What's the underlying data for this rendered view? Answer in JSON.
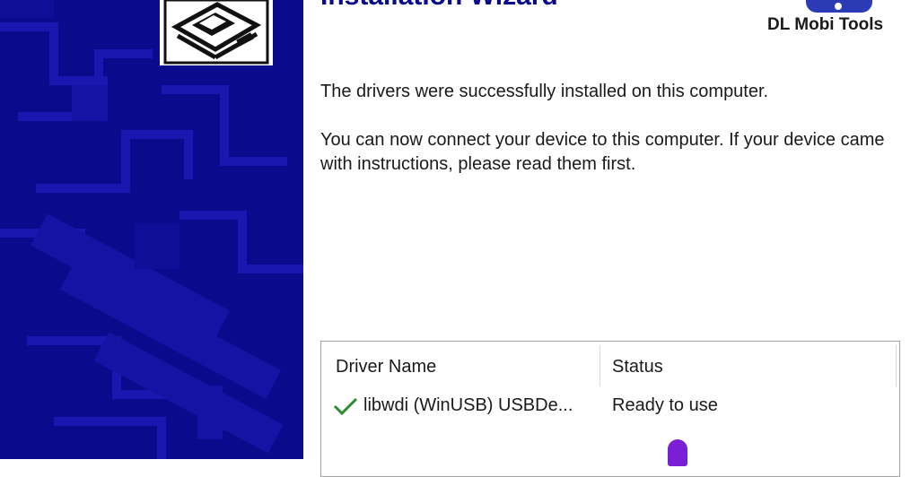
{
  "wizard": {
    "title": "Installation Wizard",
    "brand_name": "DL Mobi Tools",
    "message_success": "The drivers were successfully installed on this computer.",
    "message_connect": "You can now connect your device to this computer. If your device came with instructions, please read them first."
  },
  "driver_table": {
    "columns": [
      "Driver Name",
      "Status"
    ],
    "rows": [
      {
        "name": "libwdi (WinUSB) USBDe...",
        "status": "Ready to use",
        "icon": "checkmark-icon"
      }
    ]
  },
  "colors": {
    "panel_blue": "#0a0a8c",
    "check_green": "#2e8b2e",
    "brand_blue": "#2b3ab5"
  }
}
